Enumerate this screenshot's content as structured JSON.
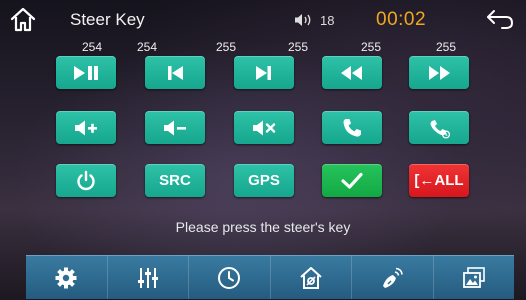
{
  "header": {
    "title": "Steer Key",
    "volume": "18",
    "clock": "00:02",
    "home_icon": "home-icon",
    "back_icon": "back-arrow-icon"
  },
  "key_values": [
    "254",
    "254",
    "255",
    "255",
    "255",
    "255"
  ],
  "keys": {
    "row1": [
      "play-pause-icon",
      "previous-track-icon",
      "next-track-icon",
      "rewind-icon",
      "fast-forward-icon"
    ],
    "row2": [
      "volume-up-icon",
      "volume-down-icon",
      "mute-icon",
      "phone-answer-icon",
      "phone-hangup-icon"
    ],
    "row3": {
      "power_icon": "power-icon",
      "src_label": "SRC",
      "gps_label": "GPS",
      "confirm_icon": "checkmark-icon",
      "clear_all_label": "[←ALL"
    }
  },
  "prompt": "Please press the steer's key",
  "bottom_tabs": [
    "gear-icon",
    "equalizer-icon",
    "clock-icon",
    "house-settings-icon",
    "satellite-icon",
    "picture-icon"
  ],
  "colors": {
    "key": "#1db39a",
    "confirm": "#1cb54e",
    "clear_all": "#e5222a",
    "clock": "#f0a81e",
    "bottom_bar": "#2f6d92"
  }
}
